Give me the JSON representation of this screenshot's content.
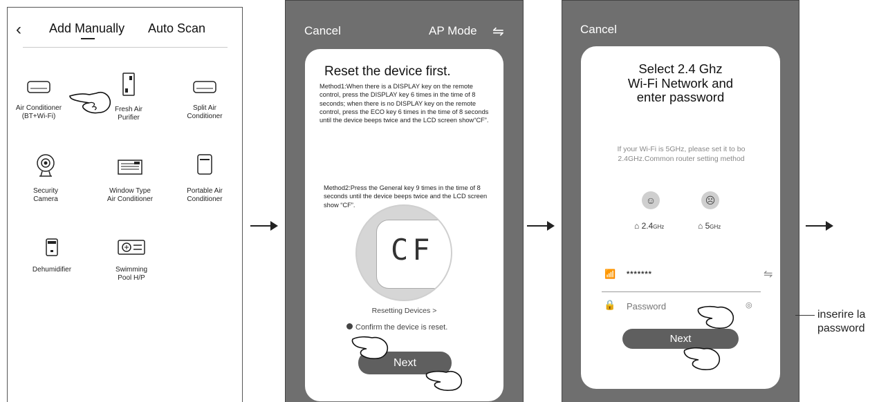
{
  "screen1": {
    "back_icon": "chevron-left-icon",
    "tabs": [
      "Add Manually",
      "Auto Scan"
    ],
    "devices": [
      {
        "label": "Air Conditioner\n(BT+Wi-Fi)",
        "icon": "air-conditioner-icon"
      },
      {
        "label": "Fresh Air\nPurifier",
        "icon": "fresh-air-purifier-icon"
      },
      {
        "label": "Split Air\nConditioner",
        "icon": "split-air-conditioner-icon"
      },
      {
        "label": "Security\nCamera",
        "icon": "security-camera-icon"
      },
      {
        "label": "Window Type\nAir Conditioner",
        "icon": "window-ac-icon"
      },
      {
        "label": "Portable Air\nConditioner",
        "icon": "portable-ac-icon"
      },
      {
        "label": "Dehumidifier",
        "icon": "dehumidifier-icon"
      },
      {
        "label": "Swimming\nPool H/P",
        "icon": "pool-heat-pump-icon"
      }
    ]
  },
  "screen2": {
    "cancel": "Cancel",
    "mode": "AP Mode",
    "title": "Reset the device first.",
    "method1": "Method1:When there is a DISPLAY key on the remote control, press the DISPLAY key 6 times in the time of 8 seconds; when there is no DISPLAY key on the remote control, press the ECO key 6 times in the time of 8 seconds until the device beeps twice and the LCD screen show“CF”.",
    "method2": "Method2:Press the General key 9 times in the time of 8 seconds until the device beeps twice and the LCD screen show “CF”.",
    "display_code": "CF",
    "resetting_link": "Resetting Devices >",
    "confirm": "Confirm the device is reset.",
    "next": "Next"
  },
  "screen3": {
    "cancel": "Cancel",
    "title_lines": [
      "Select 2.4 Ghz",
      "Wi-Fi Network and",
      "enter password"
    ],
    "hint": "If your Wi-Fi is 5GHz, please set it to bo 2.4GHz.Common router setting method",
    "band1": "2.4",
    "band2": "5",
    "band_unit": "GHz",
    "ssid": "*******",
    "password_placeholder": "Password",
    "next": "Next"
  },
  "note": {
    "line1": "inserire la",
    "line2": "password"
  }
}
